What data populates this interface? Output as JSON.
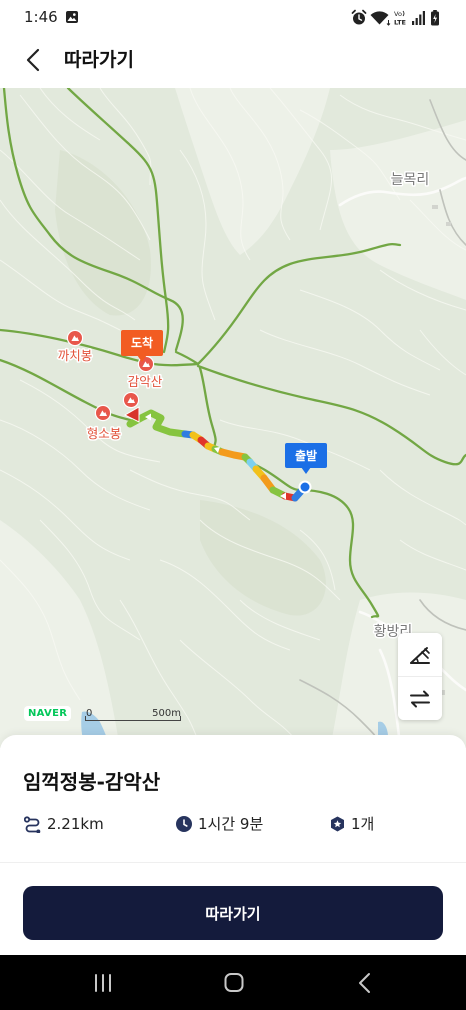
{
  "status_bar": {
    "time": "1:46",
    "volte_top": "Vo",
    "volte_bottom": "LTE",
    "icons": [
      "gallery-icon",
      "alarm-icon",
      "wifi-icon",
      "volte-icon",
      "signal-icon",
      "battery-charging-icon"
    ]
  },
  "header": {
    "back_icon": "chevron-left-icon",
    "title": "따라가기"
  },
  "map": {
    "places": {
      "neulmok_ri": "늘목리",
      "kkachibong": "까치봉",
      "gamaksan": "감악산",
      "hyeongsobong": "형소봉",
      "hwangbang_ri": "황방리"
    },
    "markers": {
      "arrival": "도착",
      "departure": "출발"
    },
    "controls": [
      "slope-icon",
      "swap-icon"
    ],
    "attribution": "NAVER",
    "scale": {
      "zero": "0",
      "distance": "500m"
    }
  },
  "course": {
    "name": "임꺽정봉-감악산",
    "distance": "2.21km",
    "duration": "1시간 9분",
    "summit_count": "1개",
    "icons": {
      "distance": "route-icon",
      "duration": "clock-icon",
      "summits": "summit-badge-icon"
    }
  },
  "follow_button": {
    "label": "따라가기"
  },
  "nav_bar": {
    "icons": [
      "recent-apps-icon",
      "home-icon",
      "back-icon"
    ]
  },
  "colors": {
    "primary_navy": "#141b3c",
    "icon_navy": "#27345e",
    "trail_green": "#72a744",
    "arrival_orange": "#f25c22",
    "departure_blue": "#1b6fe6",
    "peak_label": "#e2533b",
    "naver_green": "#03c75a"
  }
}
